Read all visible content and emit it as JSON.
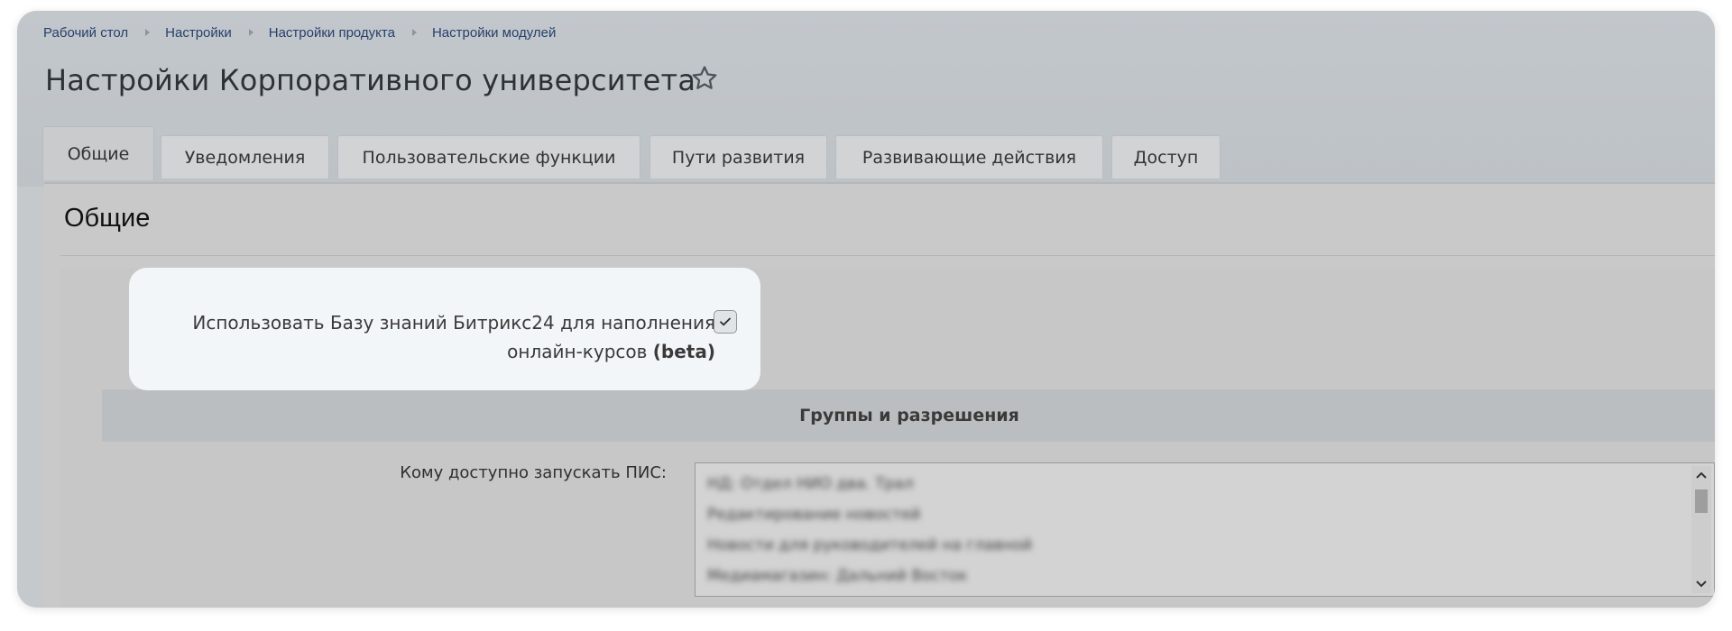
{
  "breadcrumb": [
    {
      "label": "Рабочий стол"
    },
    {
      "label": "Настройки"
    },
    {
      "label": "Настройки продукта"
    },
    {
      "label": "Настройки модулей"
    }
  ],
  "page": {
    "title": "Настройки Корпоративного университета",
    "favorite_icon": "star-outline-icon"
  },
  "tabs": [
    {
      "label": "Общие",
      "active": true
    },
    {
      "label": "Уведомления"
    },
    {
      "label": "Пользовательские функции"
    },
    {
      "label": "Пути развития"
    },
    {
      "label": "Развивающие действия"
    },
    {
      "label": "Доступ"
    }
  ],
  "section": {
    "title": "Общие"
  },
  "kb_setting": {
    "label_line1": "Использовать Базу знаний Битрикс24 для наполнения",
    "label_line2": "онлайн-курсов",
    "label_beta": "(beta)",
    "checked": true
  },
  "groups": {
    "header": "Группы и разрешения",
    "access_label": "Кому доступно запускать ПИС:",
    "options": [
      "НД: Отдел НИО два. Трал",
      "Редактирование новостей",
      "Новости для руководителей на главной",
      "Медиамагазин: Дальний Восток"
    ]
  },
  "colors": {
    "link": "#25406b",
    "card": "#f3f6f9",
    "overlay": "#c6c9cc"
  }
}
